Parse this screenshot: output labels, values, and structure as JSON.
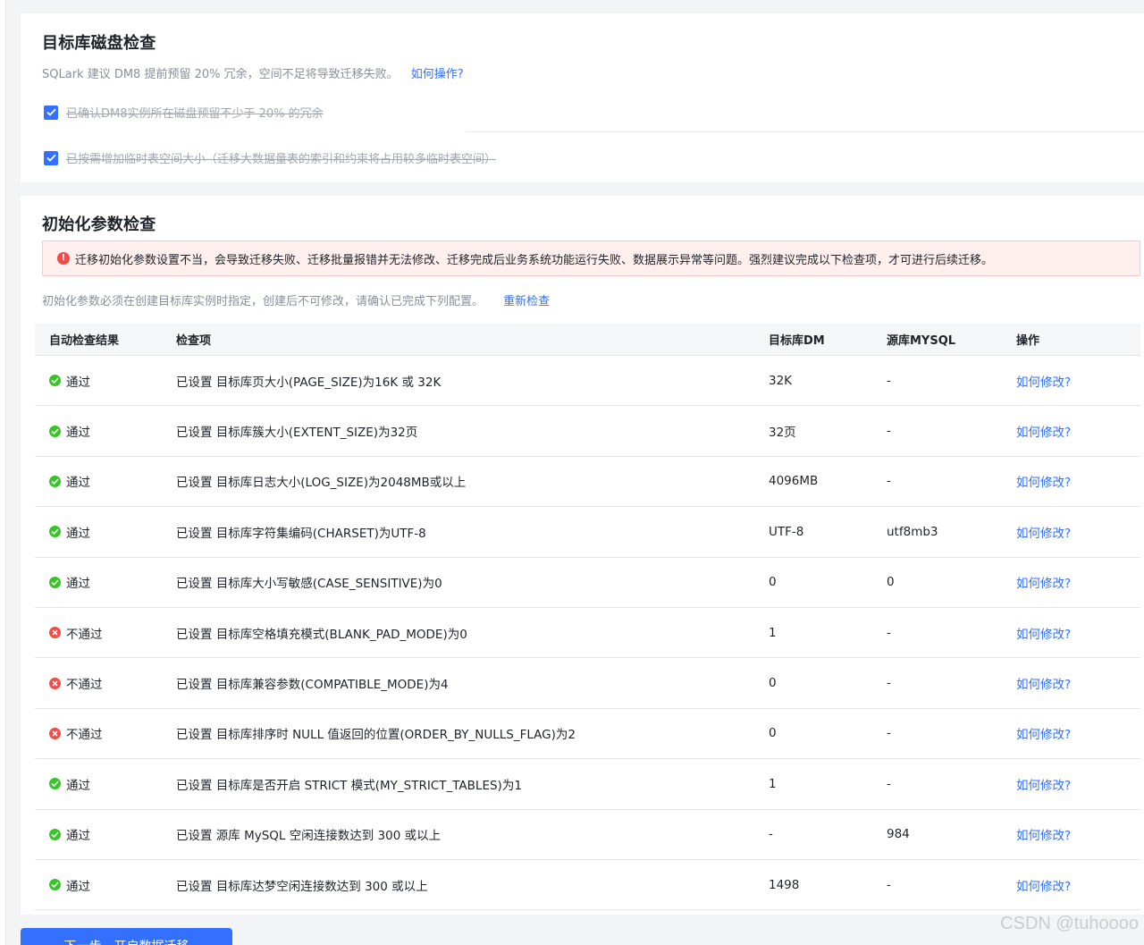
{
  "disk_check": {
    "title": "目标库磁盘检查",
    "description": "SQLark 建议 DM8 提前预留 20% 冗余，空间不足将导致迁移失败。",
    "help_link": "如何操作?",
    "checks": [
      {
        "label": "已确认DM8实例所在磁盘预留不少于 20% 的冗余",
        "checked": true
      },
      {
        "label": "已按需增加临时表空间大小（迁移大数据量表的索引和约束将占用较多临时表空间）",
        "checked": true
      }
    ]
  },
  "param_check": {
    "title": "初始化参数检查",
    "alert": "迁移初始化参数设置不当，会导致迁移失败、迁移批量报错并无法修改、迁移完成后业务系统功能运行失败、数据展示异常等问题。强烈建议完成以下检查项，才可进行后续迁移。",
    "description": "初始化参数必须在创建目标库实例时指定，创建后不可修改，请确认已完成下列配置。",
    "recheck_link": "重新检查",
    "columns": [
      "自动检查结果",
      "检查项",
      "目标库DM",
      "源库MYSQL",
      "操作"
    ],
    "rows": [
      {
        "status": "通过",
        "item": "已设置 目标库页大小(PAGE_SIZE)为16K 或 32K",
        "dm": "32K",
        "mysql": "-",
        "action": "如何修改?"
      },
      {
        "status": "通过",
        "item": "已设置 目标库簇大小(EXTENT_SIZE)为32页",
        "dm": "32页",
        "mysql": "-",
        "action": "如何修改?"
      },
      {
        "status": "通过",
        "item": "已设置 目标库日志大小(LOG_SIZE)为2048MB或以上",
        "dm": "4096MB",
        "mysql": "-",
        "action": "如何修改?"
      },
      {
        "status": "通过",
        "item": "已设置 目标库字符集编码(CHARSET)为UTF-8",
        "dm": "UTF-8",
        "mysql": "utf8mb3",
        "action": "如何修改?"
      },
      {
        "status": "通过",
        "item": "已设置 目标库大小写敏感(CASE_SENSITIVE)为0",
        "dm": "0",
        "mysql": "0",
        "action": "如何修改?"
      },
      {
        "status": "不通过",
        "item": "已设置 目标库空格填充模式(BLANK_PAD_MODE)为0",
        "dm": "1",
        "mysql": "-",
        "action": "如何修改?"
      },
      {
        "status": "不通过",
        "item": "已设置 目标库兼容参数(COMPATIBLE_MODE)为4",
        "dm": "0",
        "mysql": "-",
        "action": "如何修改?"
      },
      {
        "status": "不通过",
        "item": "已设置 目标库排序时 NULL 值返回的位置(ORDER_BY_NULLS_FLAG)为2",
        "dm": "0",
        "mysql": "-",
        "action": "如何修改?"
      },
      {
        "status": "通过",
        "item": "已设置 目标库是否开启 STRICT 模式(MY_STRICT_TABLES)为1",
        "dm": "1",
        "mysql": "-",
        "action": "如何修改?"
      },
      {
        "status": "通过",
        "item": "已设置 源库 MySQL 空闲连接数达到 300 或以上",
        "dm": "-",
        "mysql": "984",
        "action": "如何修改?"
      },
      {
        "status": "通过",
        "item": "已设置 目标库达梦空闲连接数达到 300 或以上",
        "dm": "1498",
        "mysql": "-",
        "action": "如何修改?"
      }
    ]
  },
  "footer": {
    "next_button": "下一步，开启数据迁移",
    "watermark": "CSDN @tuhoooo"
  },
  "colors": {
    "primary": "#3370ff",
    "pass": "#34c724",
    "fail": "#f54a45",
    "alert_bg": "#fff0ef"
  }
}
